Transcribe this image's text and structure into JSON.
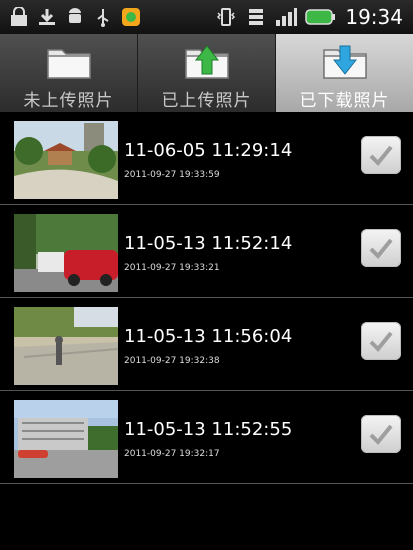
{
  "status_bar": {
    "time": "19:34",
    "icons": [
      "lock-icon",
      "download-icon",
      "android-icon",
      "usb-icon",
      "app-notification-icon",
      "vibrate-icon",
      "wifi-icon",
      "signal-icon",
      "battery-icon"
    ]
  },
  "tabs": [
    {
      "label": "未上传照片",
      "icon": "folder-icon"
    },
    {
      "label": "已上传照片",
      "icon": "folder-upload-icon"
    },
    {
      "label": "已下载照片",
      "icon": "folder-download-icon",
      "active": true
    }
  ],
  "colors": {
    "upload_arrow": "#3db847",
    "download_arrow": "#2fa6e0",
    "checkbox_check": "#9e9e9e"
  },
  "photos": [
    {
      "title": "11-06-05 11:29:14",
      "date": "2011-09-27 19:33:59",
      "checked": true
    },
    {
      "title": "11-05-13 11:52:14",
      "date": "2011-09-27 19:33:21",
      "checked": true
    },
    {
      "title": "11-05-13 11:56:04",
      "date": "2011-09-27 19:32:38",
      "checked": true
    },
    {
      "title": "11-05-13 11:52:55",
      "date": "2011-09-27 19:32:17",
      "checked": true
    }
  ]
}
